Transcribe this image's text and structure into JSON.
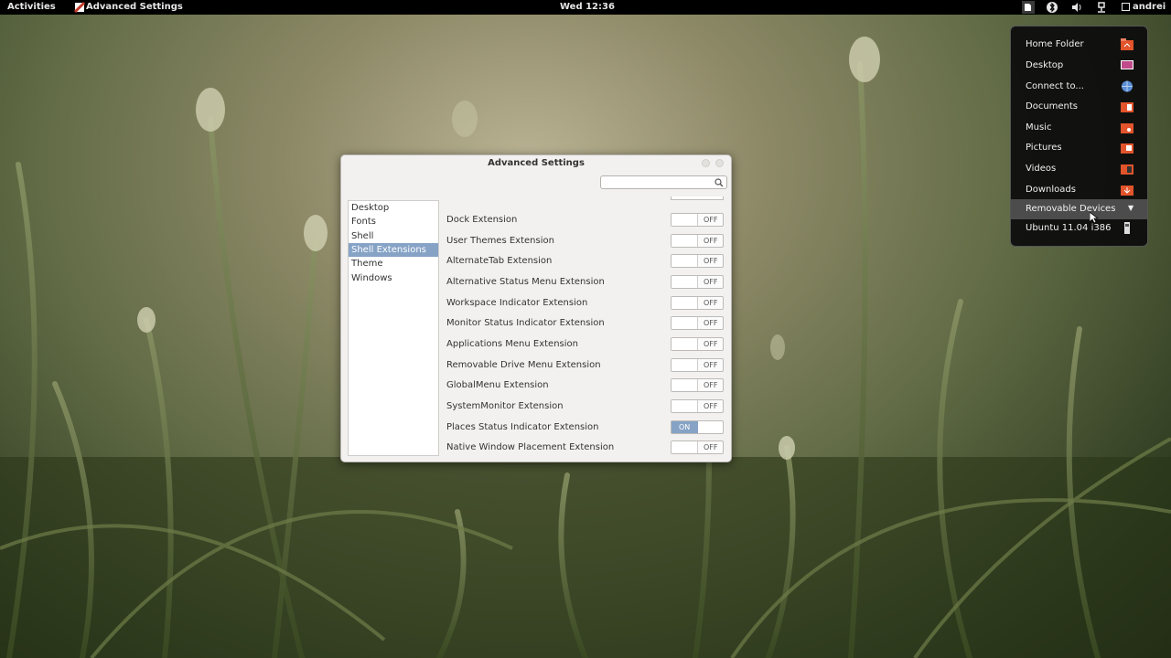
{
  "top_panel": {
    "activities": "Activities",
    "app_name": "Advanced Settings",
    "clock": "Wed 12:36",
    "user": "andrei"
  },
  "places_menu": {
    "items": [
      {
        "label": "Home Folder",
        "icon": "home-folder-icon"
      },
      {
        "label": "Desktop",
        "icon": "desktop-icon"
      },
      {
        "label": "Connect to...",
        "icon": "network-globe-icon"
      },
      {
        "label": "Documents",
        "icon": "documents-folder-icon"
      },
      {
        "label": "Music",
        "icon": "music-folder-icon"
      },
      {
        "label": "Pictures",
        "icon": "pictures-folder-icon"
      },
      {
        "label": "Videos",
        "icon": "videos-folder-icon"
      },
      {
        "label": "Downloads",
        "icon": "downloads-folder-icon"
      }
    ],
    "removable_header": "Removable Devices",
    "removable_arrow": "▼",
    "device": "Ubuntu 11.04 i386"
  },
  "window": {
    "title": "Advanced Settings",
    "search_placeholder": "",
    "sidebar": [
      "Desktop",
      "Fonts",
      "Shell",
      "Shell Extensions",
      "Theme",
      "Windows"
    ],
    "selected": "Shell Extensions",
    "extensions": [
      {
        "name": "Dock Extension",
        "state": "OFF"
      },
      {
        "name": "User Themes Extension",
        "state": "OFF"
      },
      {
        "name": "AlternateTab Extension",
        "state": "OFF"
      },
      {
        "name": "Alternative Status Menu Extension",
        "state": "OFF"
      },
      {
        "name": "Workspace Indicator Extension",
        "state": "OFF"
      },
      {
        "name": "Monitor Status Indicator Extension",
        "state": "OFF"
      },
      {
        "name": "Applications Menu Extension",
        "state": "OFF"
      },
      {
        "name": "Removable Drive Menu Extension",
        "state": "OFF"
      },
      {
        "name": "GlobalMenu Extension",
        "state": "OFF"
      },
      {
        "name": "SystemMonitor Extension",
        "state": "OFF"
      },
      {
        "name": "Places Status Indicator Extension",
        "state": "ON"
      },
      {
        "name": "Native Window Placement Extension",
        "state": "OFF"
      }
    ]
  },
  "colors": {
    "selection": "#86a3c6",
    "panel": "#000000",
    "menu_highlight": "#4c4c4c"
  }
}
